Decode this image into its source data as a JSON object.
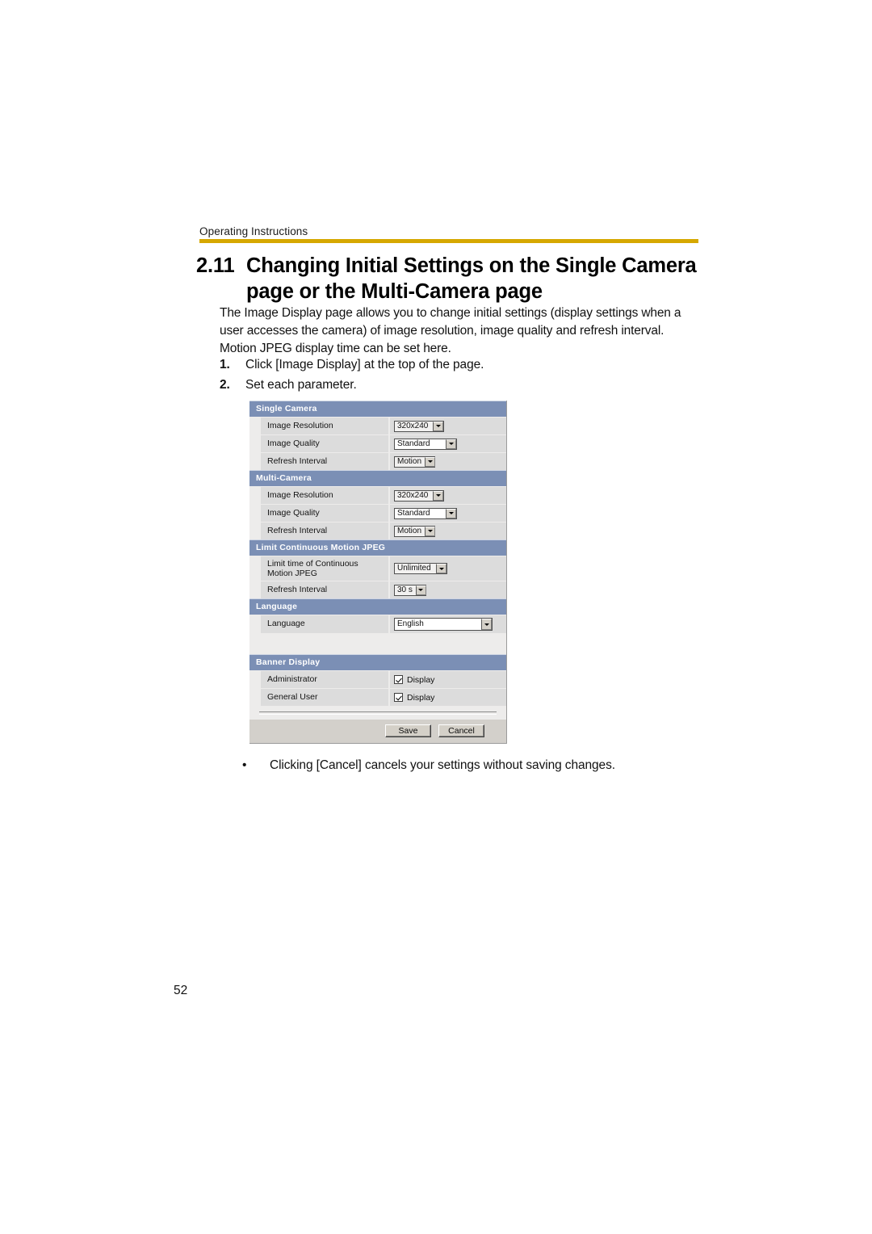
{
  "document": {
    "running_header": "Operating Instructions",
    "page_number": "52",
    "rule_color": "#d6a800"
  },
  "section": {
    "number": "2.11",
    "title": "Changing Initial Settings on the Single Camera page or the Multi-Camera page",
    "intro": "The Image Display page allows you to change initial settings (display settings when a user accesses the camera) of image resolution, image quality and refresh interval. Motion JPEG display time can be set here.",
    "steps": [
      {
        "marker": "1.",
        "text": "Click [Image Display] at the top of the page."
      },
      {
        "marker": "2.",
        "text": "Set each parameter."
      }
    ],
    "note": {
      "bullet": "•",
      "text": "Clicking [Cancel] cancels your settings without saving changes."
    }
  },
  "panel": {
    "header_color": "#7b8fb5",
    "groups": {
      "single_camera": {
        "title": "Single Camera",
        "rows": [
          {
            "label": "Image Resolution",
            "value": "320x240"
          },
          {
            "label": "Image Quality",
            "value": "Standard"
          },
          {
            "label": "Refresh Interval",
            "value": "Motion"
          }
        ]
      },
      "multi_camera": {
        "title": "Multi-Camera",
        "rows": [
          {
            "label": "Image Resolution",
            "value": "320x240"
          },
          {
            "label": "Image Quality",
            "value": "Standard"
          },
          {
            "label": "Refresh Interval",
            "value": "Motion"
          }
        ]
      },
      "limit_motion_jpeg": {
        "title": "Limit Continuous Motion JPEG",
        "rows": [
          {
            "label_line1": "Limit time of Continuous",
            "label_line2": "Motion JPEG",
            "value": "Unlimited"
          },
          {
            "label": "Refresh Interval",
            "value": "30 s"
          }
        ]
      },
      "language": {
        "title": "Language",
        "rows": [
          {
            "label": "Language",
            "value": "English"
          }
        ]
      },
      "banner_display": {
        "title": "Banner Display",
        "rows": [
          {
            "label": "Administrator",
            "checkbox_label": "Display",
            "checked": true
          },
          {
            "label": "General User",
            "checkbox_label": "Display",
            "checked": true
          }
        ]
      }
    },
    "buttons": {
      "save": "Save",
      "cancel": "Cancel"
    }
  }
}
